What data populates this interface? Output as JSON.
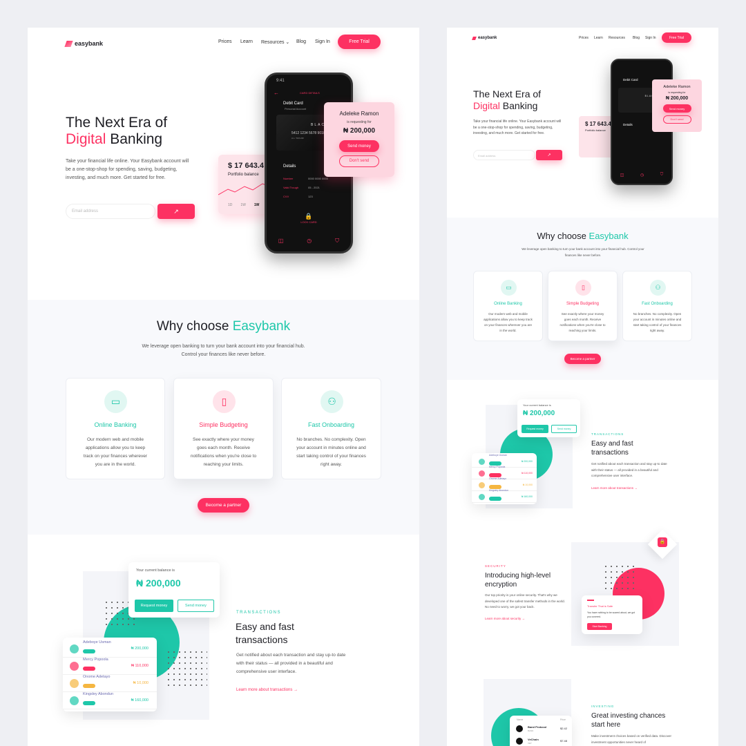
{
  "brand": {
    "name": "easybank",
    "accent": "#fd3162",
    "teal": "#1ec7a9"
  },
  "nav": {
    "items": [
      "Prices",
      "Learn",
      "Resources",
      "Blog",
      "Sign In"
    ],
    "cta": "Free Trial"
  },
  "hero": {
    "title_line1": "The Next Era of",
    "title_accent": "Digital",
    "title_rest": "Banking",
    "description": "Take your financial life online. Your Easybank account will be a one-stop-shop for spending, saving, budgeting, investing, and much more. Get started for free.",
    "email_placeholder": "Email address"
  },
  "phone": {
    "time": "9:41",
    "header": "CARD DETAILS",
    "card_title": "Debit Card",
    "card_sub": "Personal Account",
    "card_name": "BLACK CARD",
    "card_number": "5412 1234 5678 9010",
    "card_holder": "A.L. TAYLOR",
    "details_title": "Details",
    "rows": [
      {
        "label": "Number",
        "value": "0000 0000 0000"
      },
      {
        "label": "Valid Trough",
        "value": "05 - 2021"
      },
      {
        "label": "CVV",
        "value": "123"
      }
    ],
    "lock_label": "LOCK CARD"
  },
  "request_card": {
    "name": "Adeleke Ramon",
    "sub": "is requesting for",
    "amount": "₦ 200,000",
    "primary": "Send money",
    "secondary": "Don't send"
  },
  "portfolio": {
    "amount": "$ 17 643.4",
    "label": "Portfolio balance",
    "ranges": [
      "1D",
      "1W",
      "1W"
    ]
  },
  "why": {
    "title": "Why choose",
    "title_accent": "Easybank",
    "description": "We leverage open banking to turn your bank account into your financial hub. Control your finances like never before.",
    "features": [
      {
        "title": "Online Banking",
        "text": "Our modern web and mobile applications allow you to keep track on your finances wherever you are in the world.",
        "color": "#1ec7a9",
        "icon": "credit-card-icon"
      },
      {
        "title": "Simple Budgeting",
        "text": "See exactly where your money goes each month. Receive notifications when you're close to reaching your limits.",
        "color": "#fd3162",
        "icon": "phone-coin-icon"
      },
      {
        "title": "Fast Onboarding",
        "text": "No branches. No complexity. Open your account in minutes online and start taking control of your finances right away.",
        "color": "#1ec7a9",
        "icon": "people-icon"
      }
    ],
    "cta": "Become a partner"
  },
  "balance_card": {
    "label": "Your current balance is",
    "amount": "₦ 200,000",
    "primary": "Request money",
    "secondary": "Send money"
  },
  "transactions_list": [
    {
      "name": "Adeboye Usman",
      "amount": "₦ 200,000",
      "color": "#1ec7a9"
    },
    {
      "name": "Mercy Popoola",
      "amount": "₦ 110,000",
      "color": "#fd3162"
    },
    {
      "name": "Onome Adetayo",
      "amount": "₦ 10,000",
      "color": "#f5b640"
    },
    {
      "name": "Kingsley Abondun",
      "amount": "₦ 160,000",
      "color": "#1ec7a9"
    }
  ],
  "transactions": {
    "eyebrow": "TRANSACTIONS",
    "title": "Easy and fast transactions",
    "text": "Get notified about each transaction and stay up-to date with their status — all provided in a beautiful and comprehensive user interface.",
    "link": "Learn more about transactions"
  },
  "security": {
    "eyebrow": "SECURITY",
    "title": "Introducing high-level encryption",
    "text": "Our top priority is your online security. That's why we developed one of the safest transfer methods in the world. No need to worry, we got your back.",
    "link": "Learn more about security",
    "safe_title": "Transfer That is Safe",
    "safe_text": "You have nothing to be scared about, we got you covered.",
    "safe_cta": "Start Banking"
  },
  "investing": {
    "eyebrow": "INVESTING",
    "title": "Great investing chances start here",
    "text": "Make investment choices based on verified data. Discover investment opportunities never heard of",
    "col1": "Name",
    "col2": "Price",
    "coins": [
      {
        "name": "Band Protocol",
        "ticker": "BAND",
        "price": "$2.42"
      },
      {
        "name": "VeChain",
        "ticker": "VET",
        "price": "$7.48"
      }
    ]
  }
}
